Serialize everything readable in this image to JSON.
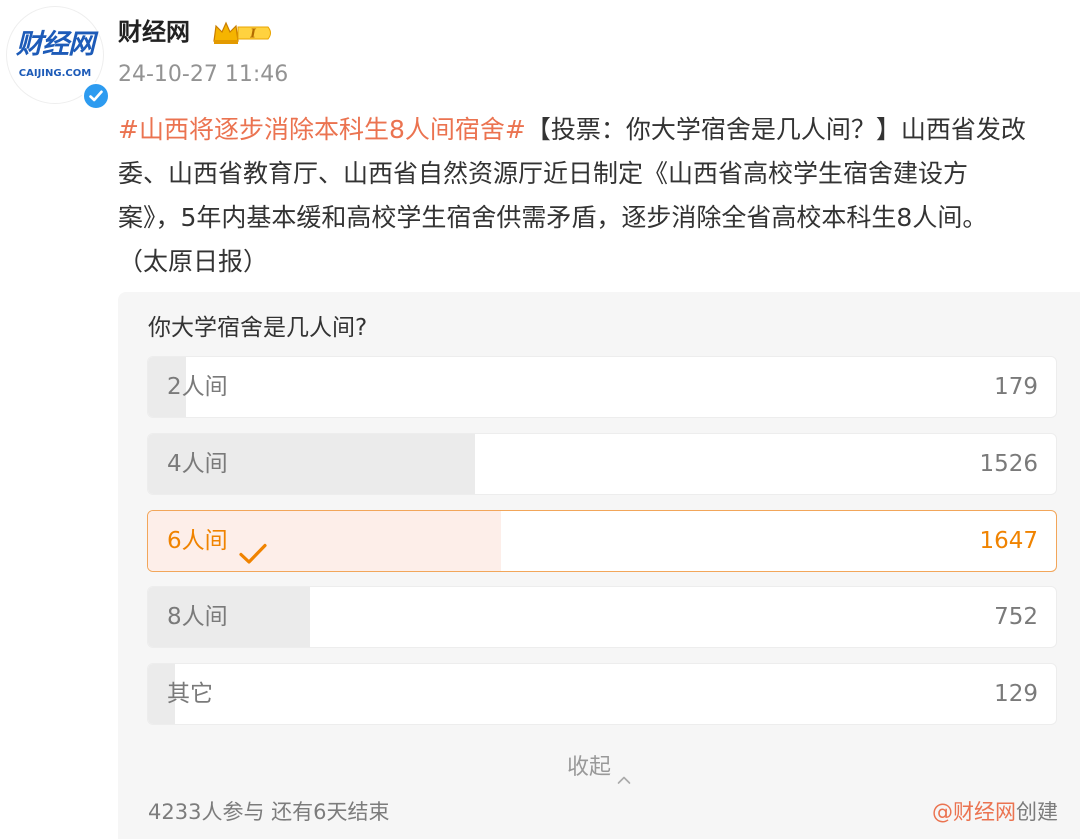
{
  "post": {
    "author": {
      "name": "财经网",
      "avatar_text": "财经网",
      "avatar_subtext": "CAIJING.COM",
      "vip_level": "I",
      "verified": true
    },
    "timestamp": "24-10-27 11:46",
    "body": {
      "hashtag": "#山西将逐步消除本科生8人间宿舍#",
      "line1_rest": "【投票：你大学宿舍是几人间？】山西省发改",
      "line2": "委、山西省教育厅、山西省自然资源厅近日制定《山西省高校学生宿舍建设方",
      "line3": "案》，5年内基本缓和高校学生宿舍供需矛盾，逐步消除全省高校本科生8人间。",
      "line4": "（太原日报）"
    }
  },
  "vote": {
    "question": "你大学宿舍是几人间?",
    "options": [
      {
        "label": "2人间",
        "count": "179",
        "share": 0.042,
        "selected": false
      },
      {
        "label": "4人间",
        "count": "1526",
        "share": 0.36,
        "selected": false
      },
      {
        "label": "6人间",
        "count": "1647",
        "share": 0.389,
        "selected": true
      },
      {
        "label": "8人间",
        "count": "752",
        "share": 0.178,
        "selected": false
      },
      {
        "label": "其它",
        "count": "129",
        "share": 0.03,
        "selected": false
      }
    ],
    "collapse_label": "收起",
    "participants": "4233人参与",
    "remaining": "还有6天结束",
    "creator_handle": "@财经网",
    "creator_suffix": "创建"
  },
  "icons": {
    "selected_check": "check-icon",
    "collapse": "chevron-up-icon",
    "verified": "verified-check-icon",
    "vip": "crown-icon"
  },
  "colors": {
    "accent": "#eb7350",
    "selected": "#f08300",
    "verified": "#2d9bf0"
  }
}
